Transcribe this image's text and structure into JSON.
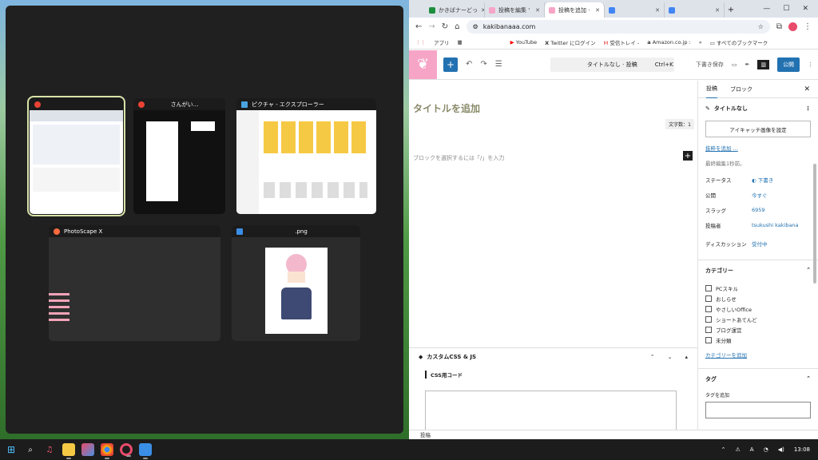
{
  "snap": {
    "windows": [
      {
        "title": "",
        "icon": "chrome-icon",
        "selected": true
      },
      {
        "title": "さんがい...",
        "icon": "chrome-icon",
        "selected": false
      },
      {
        "title": "ピクチャ - エクスプローラー",
        "icon": "explorer-icon",
        "selected": false
      },
      {
        "title": "PhotoScape X",
        "icon": "photoscape-icon",
        "selected": false
      },
      {
        "title": ".png",
        "icon": "photos-icon",
        "selected": false
      }
    ]
  },
  "browser": {
    "tabs": [
      {
        "label": "かきばナーどっ",
        "color": "#1e8e3e"
      },
      {
        "label": "投稿を編集 '",
        "color": "#f6a5c7"
      },
      {
        "label": "投稿を追加 ·",
        "color": "#f6a5c7",
        "active": true
      },
      {
        "label": "",
        "color": "#4285f4"
      },
      {
        "label": "",
        "color": "#4285f4"
      }
    ],
    "new_tab": "+",
    "url": "kakibanaaa.com",
    "bookmarks": [
      "アプリ",
      "YouTube",
      "Twitter にログイン",
      "受信トレイ -",
      "Amazon.co.jp :",
      "すべてのブックマーク"
    ]
  },
  "editor": {
    "command_label": "タイトルなし · 投稿",
    "command_shortcut": "Ctrl+K",
    "save_draft": "下書き保存",
    "publish": "公開",
    "title_placeholder": "タイトルを追加",
    "word_count": "文字数：1",
    "block_hint": "ブロックを選択するには「/」を入力",
    "metabox_title": "カスタムCSS & JS",
    "css_label": "CSS用コード",
    "footer": "投稿"
  },
  "sidebar": {
    "tab_post": "投稿",
    "tab_block": "ブロック",
    "post_title": "タイトルなし",
    "featured_image": "アイキャッチ画像を設定",
    "add_excerpt": "抜粋を追加 ...",
    "last_edited": "最終編集1秒前。",
    "rows": [
      {
        "key": "ステータス",
        "value": "下書き"
      },
      {
        "key": "公開",
        "value": "今すぐ"
      },
      {
        "key": "スラッグ",
        "value": "6959"
      },
      {
        "key": "投稿者",
        "value": "tsukushi kakibana"
      },
      {
        "key": "ディスカッション",
        "value": "受付中"
      }
    ],
    "category_heading": "カテゴリー",
    "categories": [
      "PCスキル",
      "おしらせ",
      "やさしいOffice",
      "ショートあてんど",
      "ブログ運営",
      "未分類"
    ],
    "add_category": "カテゴリーを追加",
    "tag_heading": "タグ",
    "tag_label": "タグを追加"
  },
  "taskbar": {
    "time": "13:08"
  }
}
